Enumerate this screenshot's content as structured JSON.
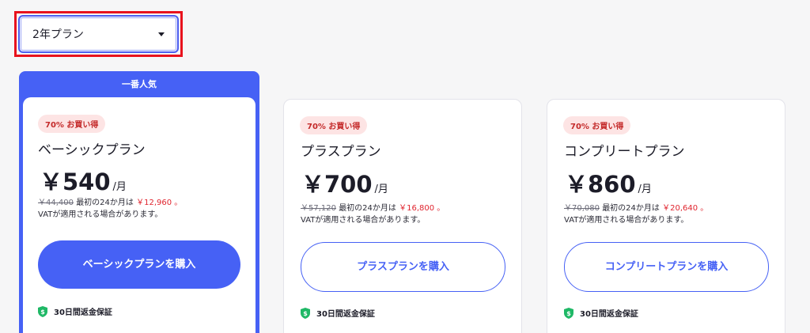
{
  "plan_selector": {
    "value": "2年プラン"
  },
  "popular_label": "一番人気",
  "cards": [
    {
      "badge": "70% お買い得",
      "name": "ベーシックプラン",
      "price": "￥540",
      "unit": "/月",
      "original": "￥44,400",
      "first_term": "最初の24か月は",
      "sale": "￥12,960 。",
      "vat": "VATが適用される場合があります。",
      "button": "ベーシックプランを購入",
      "guarantee": "30日間返金保証"
    },
    {
      "badge": "70% お買い得",
      "name": "プラスプラン",
      "price": "￥700",
      "unit": "/月",
      "original": "￥57,120",
      "first_term": "最初の24か月は",
      "sale": "￥16,800 。",
      "vat": "VATが適用される場合があります。",
      "button": "プラスプランを購入",
      "guarantee": "30日間返金保証"
    },
    {
      "badge": "70% お買い得",
      "name": "コンプリートプラン",
      "price": "￥860",
      "unit": "/月",
      "original": "￥70,080",
      "first_term": "最初の24か月は",
      "sale": "￥20,640 。",
      "vat": "VATが適用される場合があります。",
      "button": "コンプリートプランを購入",
      "guarantee": "30日間返金保証"
    }
  ],
  "colors": {
    "accent": "#4661f5",
    "sale": "#e0242e",
    "highlight": "#e8121d",
    "shield": "#1fb866"
  }
}
